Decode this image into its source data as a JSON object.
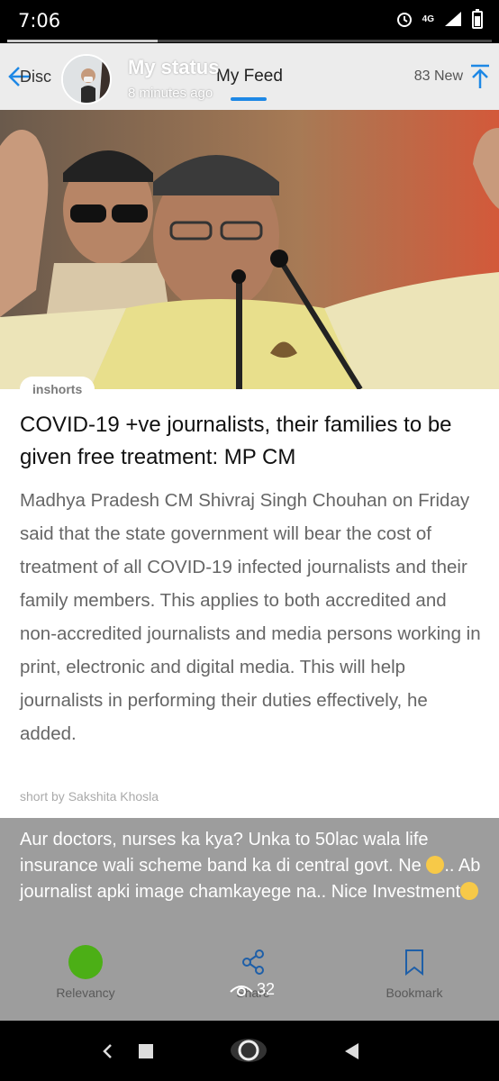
{
  "status_bar": {
    "time": "7:06",
    "network": "4G",
    "progress": 0.31
  },
  "header": {
    "back_label": "Disc",
    "tab_label": "My Feed",
    "new_count": "83 New"
  },
  "status_overlay": {
    "title": "My status",
    "time": "8 minutes ago"
  },
  "article": {
    "source": "inshorts",
    "headline": "COVID-19 +ve journalists, their families to be given free treatment: MP CM",
    "body": "Madhya Pradesh CM Shivraj Singh Chouhan on Friday said that the state government will bear the cost of treatment of all COVID-19 infected journalists and their family members. This applies to both accredited and non-accredited journalists and media persons working in print, electronic and digital media. This will help journalists in performing their duties effectively, he added.",
    "byline": "short by Sakshita Khosla"
  },
  "caption": {
    "line1": "Aur doctors, nurses ka kya? Unka to 50lac wala life insurance wali scheme band ka di central govt. Ne",
    "line2": ".. Ab journalist apki image chamkayege na.. Nice Investment"
  },
  "bottom_nav": {
    "relevancy": "Relevancy",
    "share": "Share",
    "bookmark": "Bookmark"
  },
  "views_count": "32",
  "colors": {
    "accent": "#1e88e5",
    "relevancy_dot": "#4caf16",
    "overlay": "#969696"
  }
}
